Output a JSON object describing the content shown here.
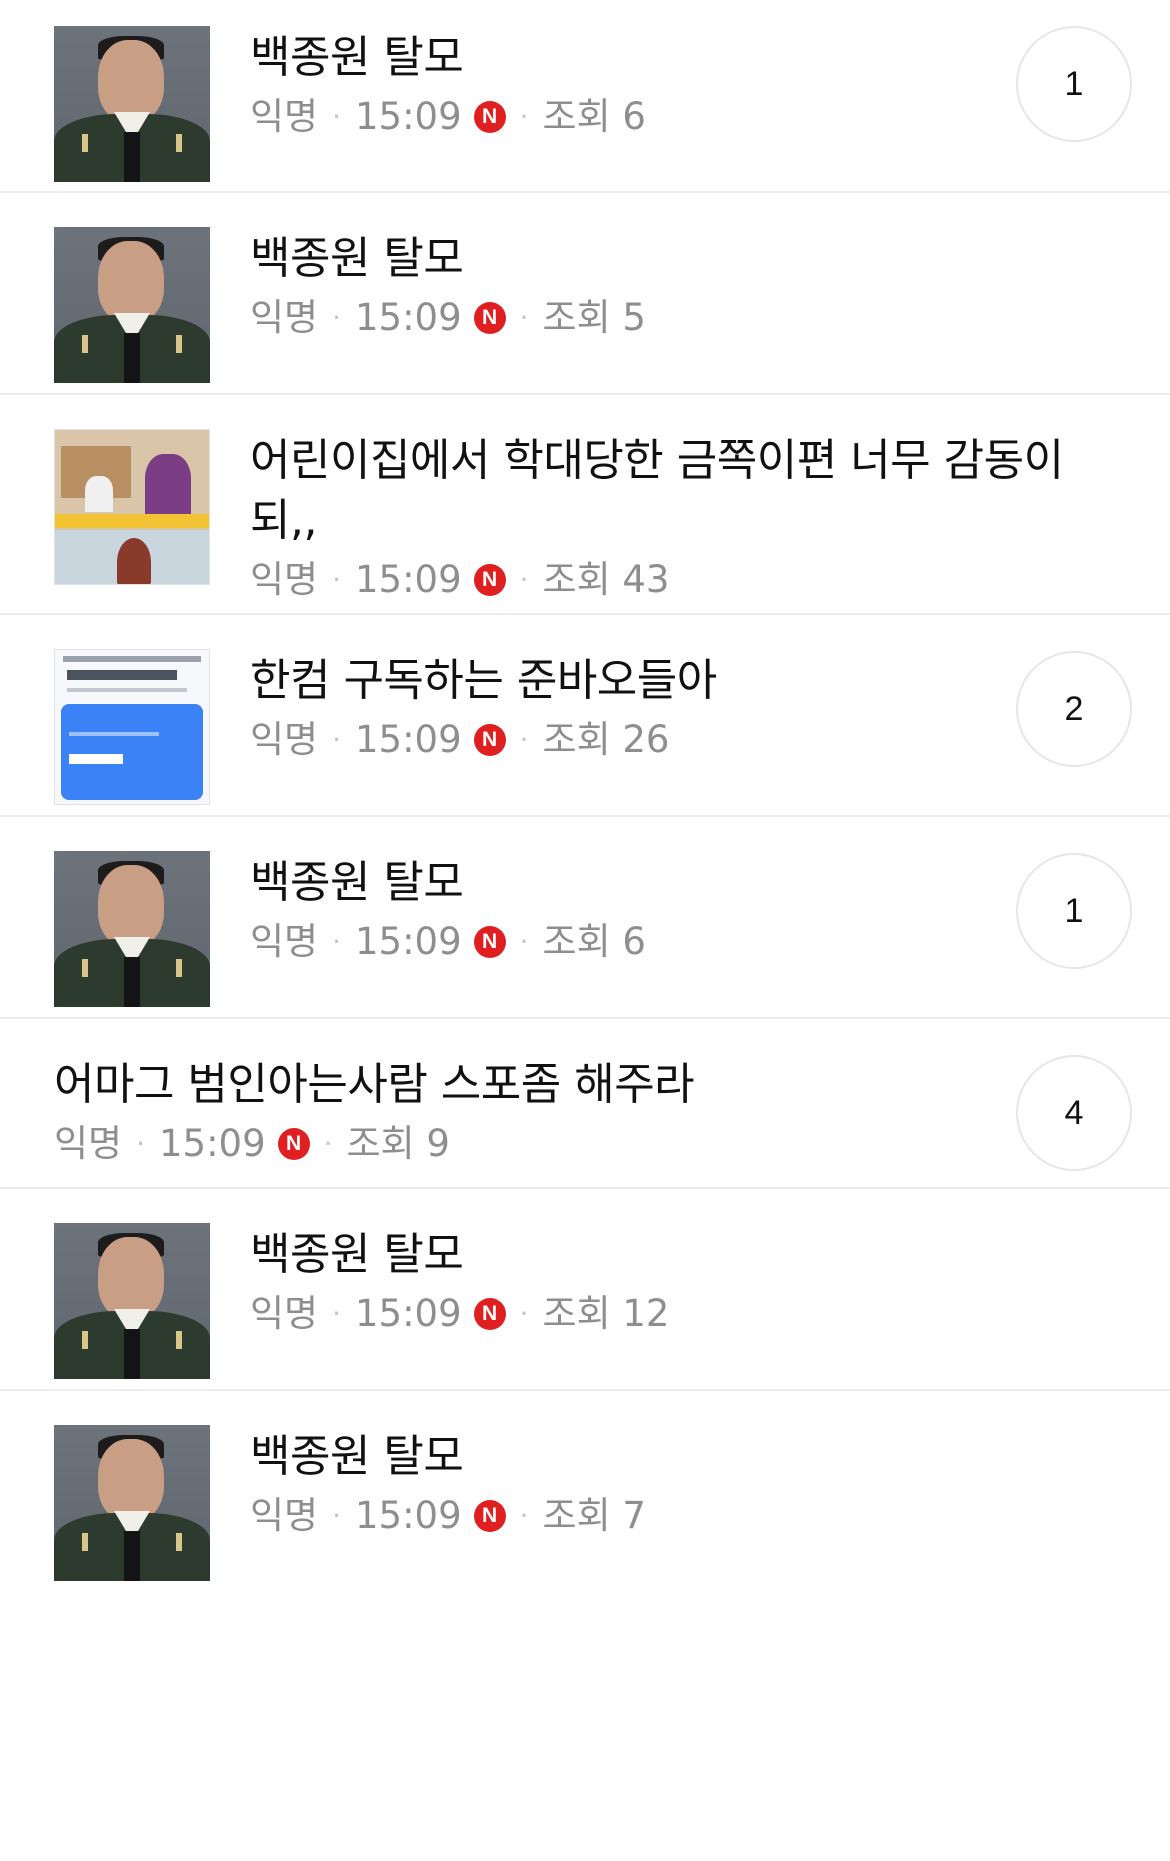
{
  "posts": [
    {
      "title": "백종원 탈모",
      "author": "익명",
      "time": "15:09",
      "new_badge": "N",
      "views": "조회 6",
      "comments": "1",
      "thumbnail": "portrait"
    },
    {
      "title": "백종원 탈모",
      "author": "익명",
      "time": "15:09",
      "new_badge": "N",
      "views": "조회 5",
      "comments": null,
      "thumbnail": "portrait"
    },
    {
      "title": "어린이집에서 학대당한 금쪽이편 너무 감동이 되,,",
      "author": "익명",
      "time": "15:09",
      "new_badge": "N",
      "views": "조회 43",
      "comments": null,
      "thumbnail": "tv-screenshot"
    },
    {
      "title": "한컴 구독하는 준바오들아",
      "author": "익명",
      "time": "15:09",
      "new_badge": "N",
      "views": "조회 26",
      "comments": "2",
      "thumbnail": "hancom-ad"
    },
    {
      "title": "백종원 탈모",
      "author": "익명",
      "time": "15:09",
      "new_badge": "N",
      "views": "조회 6",
      "comments": "1",
      "thumbnail": "portrait"
    },
    {
      "title": "어마그 범인아는사람 스포좀 해주라",
      "author": "익명",
      "time": "15:09",
      "new_badge": "N",
      "views": "조회 9",
      "comments": "4",
      "thumbnail": null
    },
    {
      "title": "백종원 탈모",
      "author": "익명",
      "time": "15:09",
      "new_badge": "N",
      "views": "조회 12",
      "comments": null,
      "thumbnail": "portrait"
    },
    {
      "title": "백종원 탈모",
      "author": "익명",
      "time": "15:09",
      "new_badge": "N",
      "views": "조회 7",
      "comments": null,
      "thumbnail": "portrait"
    }
  ],
  "colors": {
    "new_badge": "#e02020",
    "meta_text": "#8e8e8e",
    "divider": "#ececec"
  }
}
